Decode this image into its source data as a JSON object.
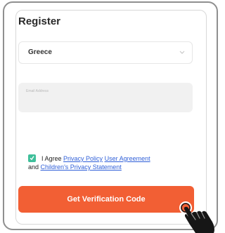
{
  "screen": {
    "title": "Register"
  },
  "form": {
    "country": "Greece",
    "email_placeholder": "Email Address"
  },
  "agreement": {
    "prefix": "I Agree",
    "privacy_policy": "Privacy Policy",
    "user_agreement": "User Agreement",
    "connector": "and",
    "children_privacy": "Children's Privacy Statement",
    "checked": true
  },
  "actions": {
    "verify_button": "Get Verification Code"
  },
  "colors": {
    "accent": "#f25f34",
    "checkbox": "#3fbf9a",
    "link": "#2f5fd8"
  },
  "icons": [
    "chevron-down-icon",
    "check-icon",
    "hand-pointer-icon"
  ]
}
